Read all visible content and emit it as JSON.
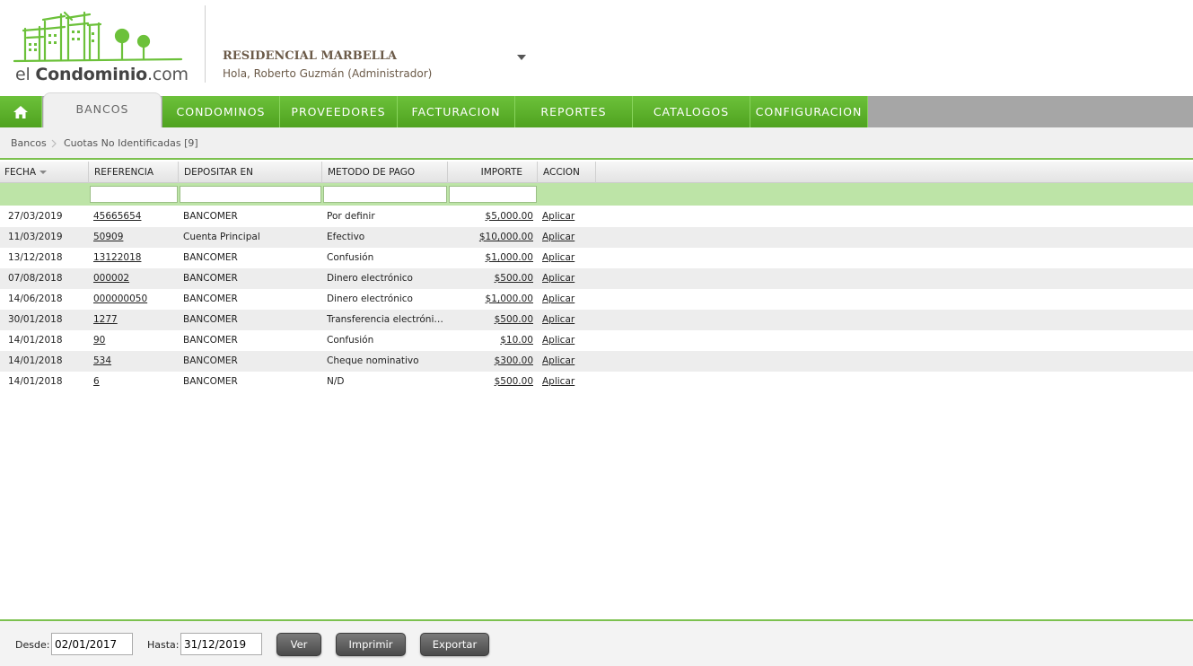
{
  "brand": {
    "logo_prefix": "el ",
    "logo_bold": "Condominio",
    "logo_suffix": ".com",
    "green": "#6cc13a"
  },
  "header": {
    "condo_name": "RESIDENCIAL MARBELLA",
    "greeting": "Hola, Roberto Guzmán (Administrador)"
  },
  "nav": {
    "home_icon": "home-icon",
    "items": [
      {
        "label": "BANCOS",
        "active": true
      },
      {
        "label": "CONDOMINOS"
      },
      {
        "label": "PROVEEDORES"
      },
      {
        "label": "FACTURACION"
      },
      {
        "label": "REPORTES"
      },
      {
        "label": "CATALOGOS"
      },
      {
        "label": "CONFIGURACION"
      }
    ]
  },
  "breadcrumb": {
    "root": "Bancos",
    "current": "Cuotas No Identificadas [9]"
  },
  "grid": {
    "columns": [
      "FECHA",
      "REFERENCIA",
      "DEPOSITAR EN",
      "METODO DE PAGO",
      "IMPORTE",
      "ACCION"
    ],
    "rows": [
      {
        "fecha": "27/03/2019",
        "referencia": "45665654",
        "depositar": "BANCOMER",
        "metodo": "Por definir",
        "importe": "$5,000.00",
        "accion": "Aplicar"
      },
      {
        "fecha": "11/03/2019",
        "referencia": "50909",
        "depositar": "Cuenta Principal",
        "metodo": "Efectivo",
        "importe": "$10,000.00",
        "accion": "Aplicar"
      },
      {
        "fecha": "13/12/2018",
        "referencia": "13122018",
        "depositar": "BANCOMER",
        "metodo": "Confusión",
        "importe": "$1,000.00",
        "accion": "Aplicar"
      },
      {
        "fecha": "07/08/2018",
        "referencia": "000002",
        "depositar": "BANCOMER",
        "metodo": "Dinero electrónico",
        "importe": "$500.00",
        "accion": "Aplicar"
      },
      {
        "fecha": "14/06/2018",
        "referencia": "000000050",
        "depositar": "BANCOMER",
        "metodo": "Dinero electrónico",
        "importe": "$1,000.00",
        "accion": "Aplicar"
      },
      {
        "fecha": "30/01/2018",
        "referencia": "1277",
        "depositar": "BANCOMER",
        "metodo": "Transferencia electrónic...",
        "importe": "$500.00",
        "accion": "Aplicar"
      },
      {
        "fecha": "14/01/2018",
        "referencia": "90",
        "depositar": "BANCOMER",
        "metodo": "Confusión",
        "importe": "$10.00",
        "accion": "Aplicar"
      },
      {
        "fecha": "14/01/2018",
        "referencia": "534",
        "depositar": "BANCOMER",
        "metodo": "Cheque nominativo",
        "importe": "$300.00",
        "accion": "Aplicar"
      },
      {
        "fecha": "14/01/2018",
        "referencia": "6",
        "depositar": "BANCOMER",
        "metodo": "N/D",
        "importe": "$500.00",
        "accion": "Aplicar"
      }
    ]
  },
  "footer": {
    "desde_label": "Desde:",
    "desde_value": "02/01/2017",
    "hasta_label": "Hasta:",
    "hasta_value": "31/12/2019",
    "ver_label": "Ver",
    "imprimir_label": "Imprimir",
    "exportar_label": "Exportar"
  }
}
